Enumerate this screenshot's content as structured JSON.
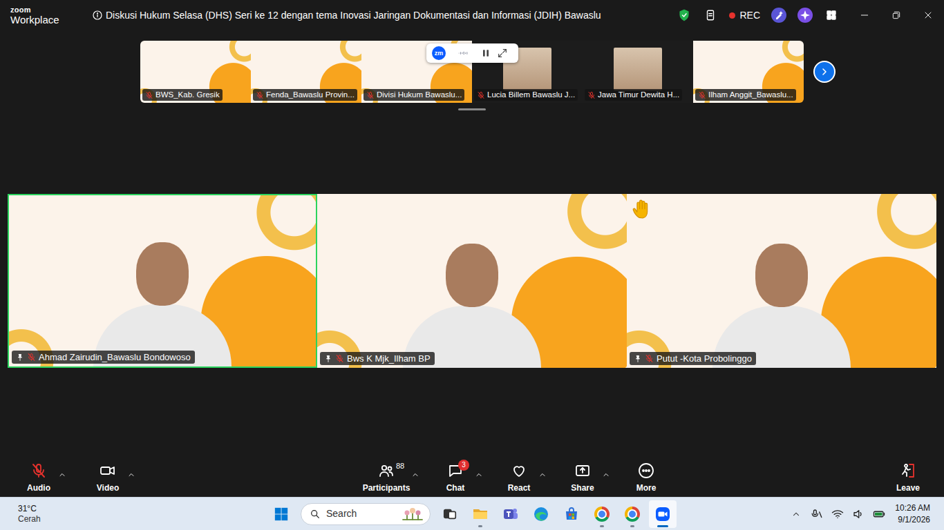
{
  "window": {
    "logo_top": "zoom",
    "logo_bottom": "Workplace",
    "title": "Diskusi Hukum Selasa (DHS) Seri ke 12 dengan tema Inovasi Jaringan Dokumentasi dan Informasi (JDIH) Bawaslu",
    "recording": true,
    "rec_label": "REC"
  },
  "thumbnails": [
    {
      "name": "BWS_Kab. Gresik",
      "muted": true,
      "kind": "slide"
    },
    {
      "name": "Fenda_Bawaslu Provin...",
      "muted": true,
      "kind": "slide"
    },
    {
      "name": "Divisi Hukum Bawaslu...",
      "muted": true,
      "kind": "slide"
    },
    {
      "name": "Lucia Billem Bawaslu J...",
      "muted": true,
      "kind": "camera"
    },
    {
      "name": "Jawa Timur Dewita H...",
      "muted": true,
      "kind": "camera"
    },
    {
      "name": "Ilham Anggit_Bawaslu...",
      "muted": true,
      "kind": "slide"
    }
  ],
  "recording_widget": {
    "logo": "zm",
    "paused": false
  },
  "gallery": [
    {
      "name": "Ahmad Zairudin_Bawaslu Bondowoso",
      "muted": true,
      "pinned": true,
      "active_speaker": true,
      "hand_raised": false
    },
    {
      "name": "Bws K Mjk_Ilham BP",
      "muted": true,
      "pinned": true,
      "active_speaker": false,
      "hand_raised": false
    },
    {
      "name": "Putut -Kota Probolinggo",
      "muted": true,
      "pinned": true,
      "active_speaker": false,
      "hand_raised": true
    }
  ],
  "toolbar": [
    {
      "label": "Audio",
      "kind": "audio",
      "muted": true
    },
    {
      "label": "Video",
      "kind": "video"
    },
    {
      "label": "Participants",
      "kind": "participants",
      "count": "88"
    },
    {
      "label": "Chat",
      "kind": "chat",
      "badge": "3"
    },
    {
      "label": "React",
      "kind": "react"
    },
    {
      "label": "Share",
      "kind": "share"
    },
    {
      "label": "More",
      "kind": "more"
    },
    {
      "label": "Leave",
      "kind": "leave"
    }
  ],
  "taskbar": {
    "weather": {
      "temp": "31°C",
      "condition": "Cerah"
    },
    "search": {
      "label": "Search"
    },
    "apps": [
      {
        "kind": "taskview",
        "running": false,
        "active": false
      },
      {
        "kind": "explorer",
        "running": true,
        "active": false
      },
      {
        "kind": "teams",
        "running": false,
        "active": false
      },
      {
        "kind": "edge",
        "running": false,
        "active": false
      },
      {
        "kind": "store",
        "running": false,
        "active": false
      },
      {
        "kind": "chrome",
        "running": true,
        "active": false
      },
      {
        "kind": "chrome",
        "running": true,
        "active": false
      },
      {
        "kind": "zoom",
        "running": true,
        "active": true
      }
    ],
    "time": "10:26 AM",
    "date": "9/1/2026"
  }
}
